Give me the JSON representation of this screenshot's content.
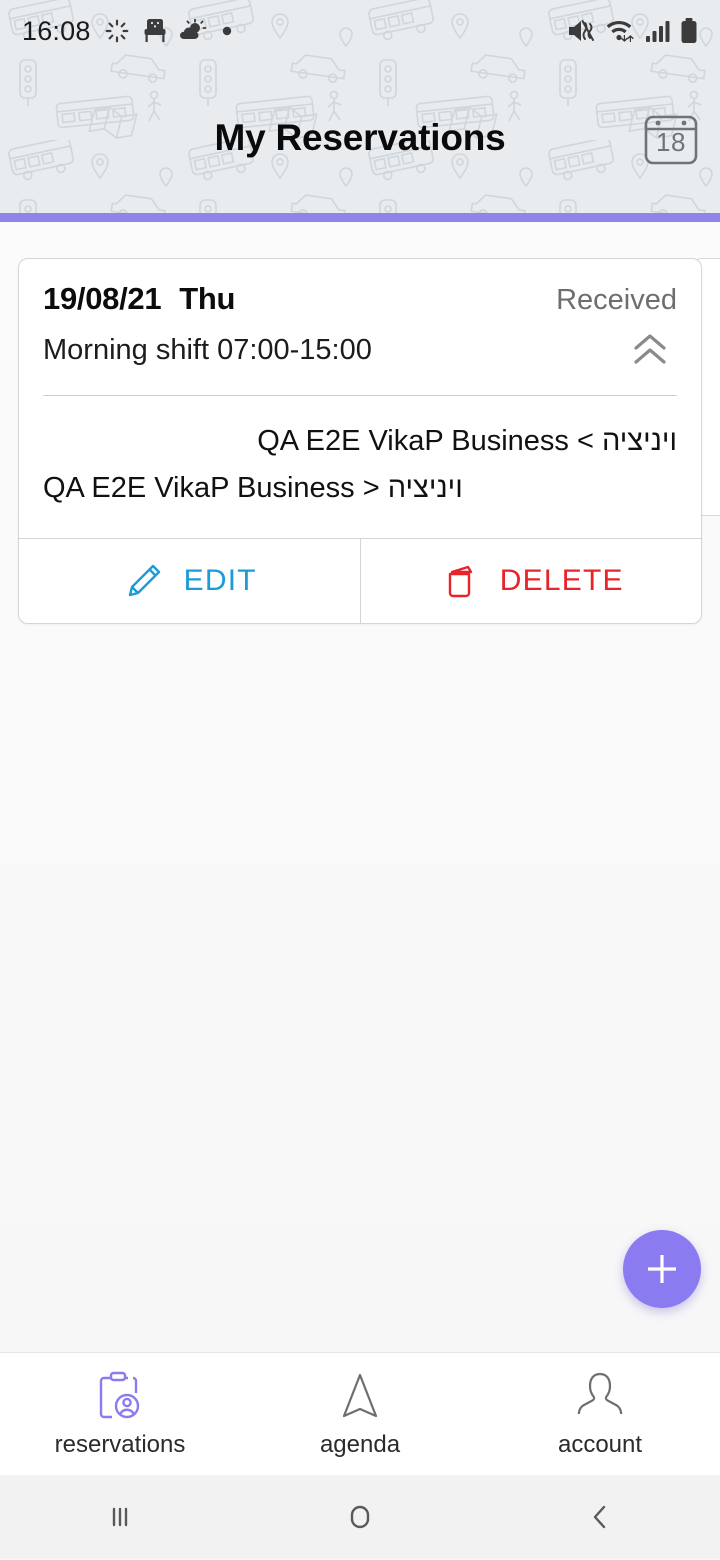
{
  "status_bar": {
    "time": "16:08",
    "left_icons": [
      "loading-spinner-icon",
      "chair-icon",
      "weather-partly-cloudy-icon",
      "dot-icon"
    ],
    "right_icons": [
      "mute-vibrate-icon",
      "wifi-icon",
      "signal-bars-icon",
      "battery-icon"
    ]
  },
  "header": {
    "title": "My Reservations",
    "calendar_day": "18",
    "calendar_icon": "calendar-icon",
    "accent_color": "#8f85e8",
    "background": "transport-pattern"
  },
  "card": {
    "date": "19/08/21",
    "day_of_week": "Thu",
    "status": "Received",
    "shift": "Morning shift 07:00-15:00",
    "collapse_icon": "double-chevron-up-icon",
    "routes": [
      "ויניציה > QA E2E VikaP Business",
      "QA E2E VikaP Business > ויניציה"
    ],
    "actions": [
      {
        "label": "EDIT",
        "icon": "pencil-icon",
        "color": "#1a9cd8"
      },
      {
        "label": "DELETE",
        "icon": "trash-icon",
        "color": "#e8242a"
      }
    ]
  },
  "fab": {
    "icon": "plus-icon",
    "color": "#8a7cf0"
  },
  "bottom_nav": {
    "items": [
      {
        "label": "reservations",
        "icon": "clipboard-person-icon",
        "active": true
      },
      {
        "label": "agenda",
        "icon": "navigation-arrow-icon",
        "active": false
      },
      {
        "label": "account",
        "icon": "person-icon",
        "active": false
      }
    ]
  },
  "system_nav": {
    "recents": "recents-icon",
    "home": "home-icon",
    "back": "back-icon"
  }
}
